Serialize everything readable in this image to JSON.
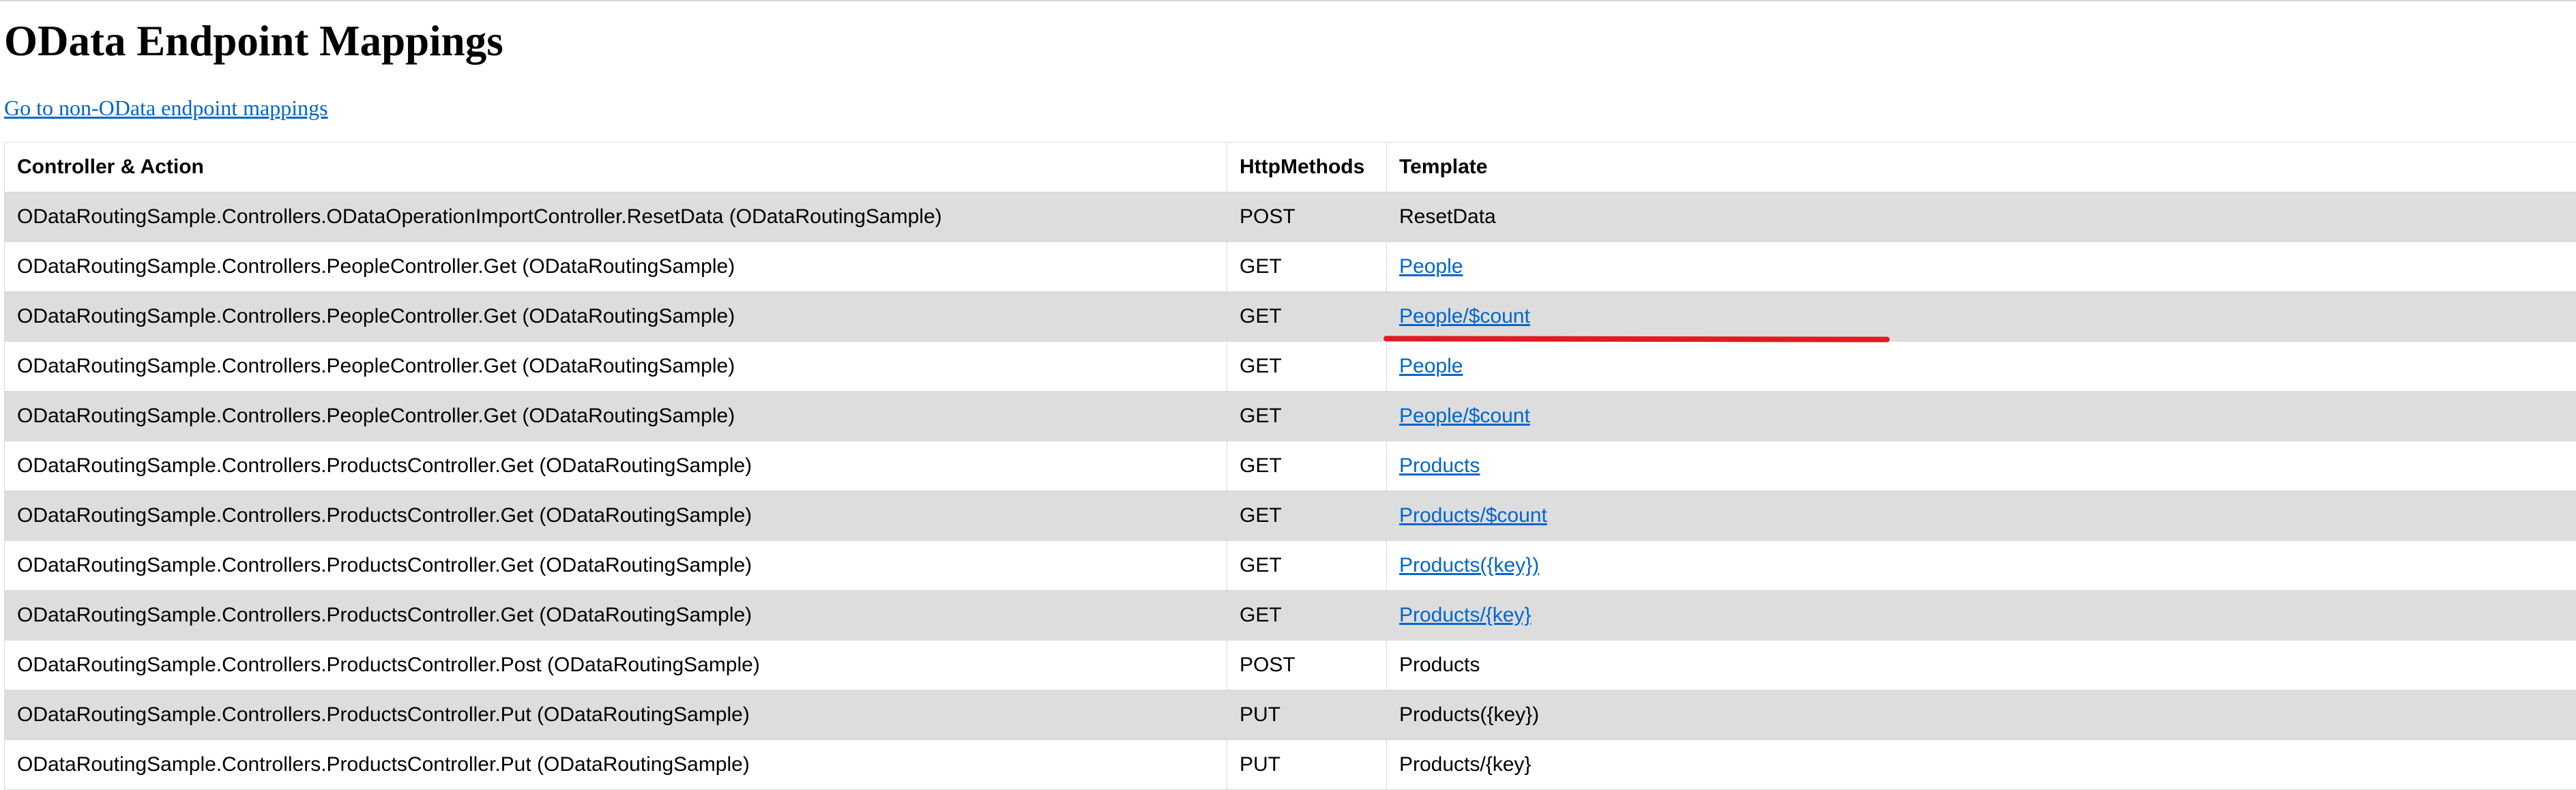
{
  "page": {
    "title": "OData Endpoint Mappings",
    "nav_link": "Go to non-OData endpoint mappings"
  },
  "table": {
    "headers": [
      "Controller & Action",
      "HttpMethods",
      "Template"
    ],
    "rows": [
      {
        "action": "ODataRoutingSample.Controllers.ODataOperationImportController.ResetData (ODataRoutingSample)",
        "method": "POST",
        "template": "ResetData",
        "is_link": false
      },
      {
        "action": "ODataRoutingSample.Controllers.PeopleController.Get (ODataRoutingSample)",
        "method": "GET",
        "template": "People",
        "is_link": true
      },
      {
        "action": "ODataRoutingSample.Controllers.PeopleController.Get (ODataRoutingSample)",
        "method": "GET",
        "template": "People/$count",
        "is_link": true
      },
      {
        "action": "ODataRoutingSample.Controllers.PeopleController.Get (ODataRoutingSample)",
        "method": "GET",
        "template": "People",
        "is_link": true
      },
      {
        "action": "ODataRoutingSample.Controllers.PeopleController.Get (ODataRoutingSample)",
        "method": "GET",
        "template": "People/$count",
        "is_link": true
      },
      {
        "action": "ODataRoutingSample.Controllers.ProductsController.Get (ODataRoutingSample)",
        "method": "GET",
        "template": "Products",
        "is_link": true
      },
      {
        "action": "ODataRoutingSample.Controllers.ProductsController.Get (ODataRoutingSample)",
        "method": "GET",
        "template": "Products/$count",
        "is_link": true
      },
      {
        "action": "ODataRoutingSample.Controllers.ProductsController.Get (ODataRoutingSample)",
        "method": "GET",
        "template": "Products({key})",
        "is_link": true
      },
      {
        "action": "ODataRoutingSample.Controllers.ProductsController.Get (ODataRoutingSample)",
        "method": "GET",
        "template": "Products/{key}",
        "is_link": true
      },
      {
        "action": "ODataRoutingSample.Controllers.ProductsController.Post (ODataRoutingSample)",
        "method": "POST",
        "template": "Products",
        "is_link": false
      },
      {
        "action": "ODataRoutingSample.Controllers.ProductsController.Put (ODataRoutingSample)",
        "method": "PUT",
        "template": "Products({key})",
        "is_link": false
      },
      {
        "action": "ODataRoutingSample.Controllers.ProductsController.Put (ODataRoutingSample)",
        "method": "PUT",
        "template": "Products/{key}",
        "is_link": false
      }
    ]
  },
  "colors": {
    "link": "#0066cc",
    "stripe": "#dddddd",
    "annotation": "#e01b24"
  }
}
